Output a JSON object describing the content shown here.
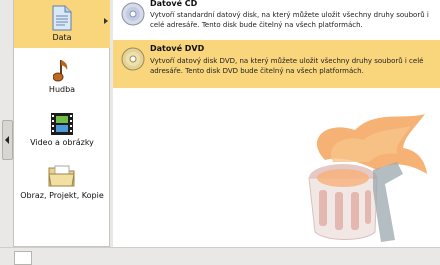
{
  "sidebar": {
    "items": [
      {
        "label": "Data",
        "icon": "document-icon",
        "selected": true
      },
      {
        "label": "Hudba",
        "icon": "music-note-icon"
      },
      {
        "label": "Video a obrázky",
        "icon": "film-strip-icon"
      },
      {
        "label": "Obraz, Projekt, Kopie",
        "icon": "folder-icon"
      }
    ]
  },
  "projects": [
    {
      "title": "Datové CD",
      "desc": "Vytvoří standardní datový disk, na který můžete uložit všechny druhy souborů i celé adresáře. Tento disk bude čitelný na všech platformách.",
      "icon": "cd-disc-icon"
    },
    {
      "title": "Datové DVD",
      "desc": "Vytvoří datový disk DVD, na který můžete uložit všechny druhy souborů i celé adresáře. Tento disk DVD bude čitelný na všech platformách.",
      "icon": "dvd-disc-icon",
      "selected": true
    }
  ],
  "colors": {
    "selection": "#f9d57c",
    "flame": "#f08a3a"
  }
}
